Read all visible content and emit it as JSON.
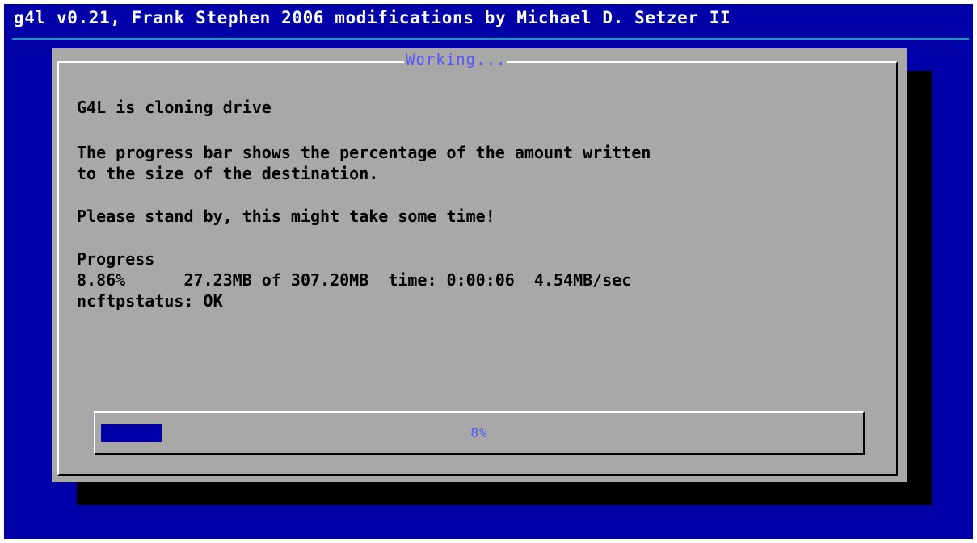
{
  "colors": {
    "screen_background": "#0000a8",
    "backtitle_text": "#ffffff",
    "backtitle_rule": "#00a8a8",
    "dialog_background": "#a8a8a8",
    "dialog_title_text": "#5555ff",
    "message_text": "#000000",
    "gauge_fill": "#0000a8",
    "gauge_text": "#5555ff",
    "shadow": "#000000"
  },
  "backtitle": "g4l v0.21, Frank Stephen 2006 modifications by Michael D. Setzer II",
  "dialog": {
    "title": "Working...",
    "lines": [
      "G4L is cloning drive",
      "The progress bar shows the percentage of the amount written",
      "to the size of the destination.",
      "Please stand by, this might take some time!",
      "Progress",
      "8.86%      27.23MB of 307.20MB  time: 0:00:06  4.54MB/sec",
      "ncftpstatus: OK"
    ]
  },
  "gauge": {
    "percent": 8,
    "label": "8%"
  }
}
